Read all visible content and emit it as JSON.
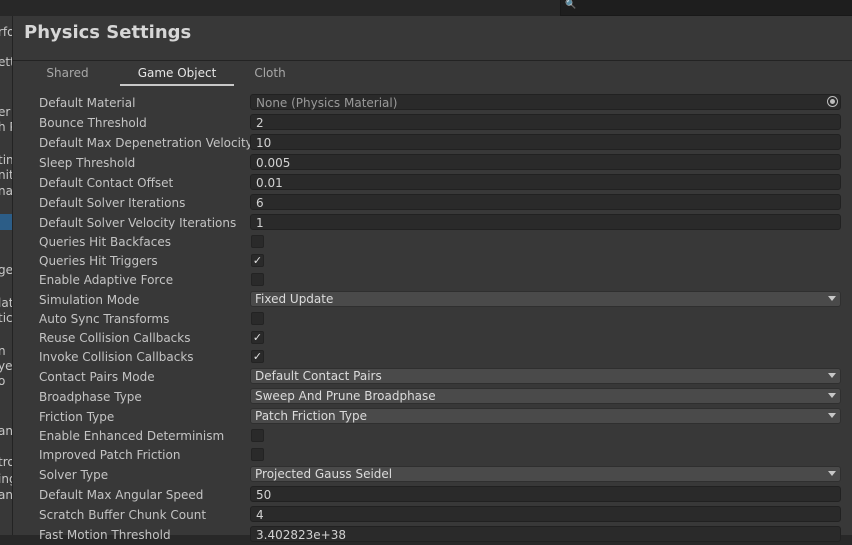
{
  "sidebar": {
    "fragments": [
      "rfo",
      "ett",
      "er",
      "h P",
      "tin",
      "nit",
      "na",
      "",
      "ge",
      "lat",
      "tic",
      "n",
      "ye",
      "o",
      "an",
      "tro",
      "ing",
      "an"
    ]
  },
  "panel": {
    "title": "Physics Settings",
    "tabs": [
      {
        "label": "Shared",
        "active": false
      },
      {
        "label": "Game Object",
        "active": true
      },
      {
        "label": "Cloth",
        "active": false
      }
    ]
  },
  "settings": [
    {
      "label": "Default Material",
      "type": "object",
      "value": "None (Physics Material)"
    },
    {
      "label": "Bounce Threshold",
      "type": "field",
      "value": "2"
    },
    {
      "label": "Default Max Depenetration Velocity",
      "type": "field",
      "value": "10"
    },
    {
      "label": "Sleep Threshold",
      "type": "field",
      "value": "0.005"
    },
    {
      "label": "Default Contact Offset",
      "type": "field",
      "value": "0.01"
    },
    {
      "label": "Default Solver Iterations",
      "type": "field",
      "value": "6"
    },
    {
      "label": "Default Solver Velocity Iterations",
      "type": "field",
      "value": "1"
    },
    {
      "label": "Queries Hit Backfaces",
      "type": "check",
      "checked": false
    },
    {
      "label": "Queries Hit Triggers",
      "type": "check",
      "checked": true
    },
    {
      "label": "Enable Adaptive Force",
      "type": "check",
      "checked": false
    },
    {
      "label": "Simulation Mode",
      "type": "dropdown",
      "value": "Fixed Update"
    },
    {
      "label": "Auto Sync Transforms",
      "type": "check",
      "checked": false
    },
    {
      "label": "Reuse Collision Callbacks",
      "type": "check",
      "checked": true
    },
    {
      "label": "Invoke Collision Callbacks",
      "type": "check",
      "checked": true
    },
    {
      "label": "Contact Pairs Mode",
      "type": "dropdown",
      "value": "Default Contact Pairs"
    },
    {
      "label": "Broadphase Type",
      "type": "dropdown",
      "value": "Sweep And Prune Broadphase"
    },
    {
      "label": "Friction Type",
      "type": "dropdown",
      "value": "Patch Friction Type"
    },
    {
      "label": "Enable Enhanced Determinism",
      "type": "check",
      "checked": false
    },
    {
      "label": "Improved Patch Friction",
      "type": "check",
      "checked": false
    },
    {
      "label": "Solver Type",
      "type": "dropdown",
      "value": "Projected Gauss Seidel"
    },
    {
      "label": "Default Max Angular Speed",
      "type": "field",
      "value": "50"
    },
    {
      "label": "Scratch Buffer Chunk Count",
      "type": "field",
      "value": "4"
    },
    {
      "label": "Fast Motion Threshold",
      "type": "field",
      "value": "3.402823e+38"
    }
  ],
  "icons": {
    "search": "search-icon",
    "object_picker": "object-picker-icon",
    "dropdown": "chevron-down-icon",
    "check": "checkmark-icon"
  }
}
